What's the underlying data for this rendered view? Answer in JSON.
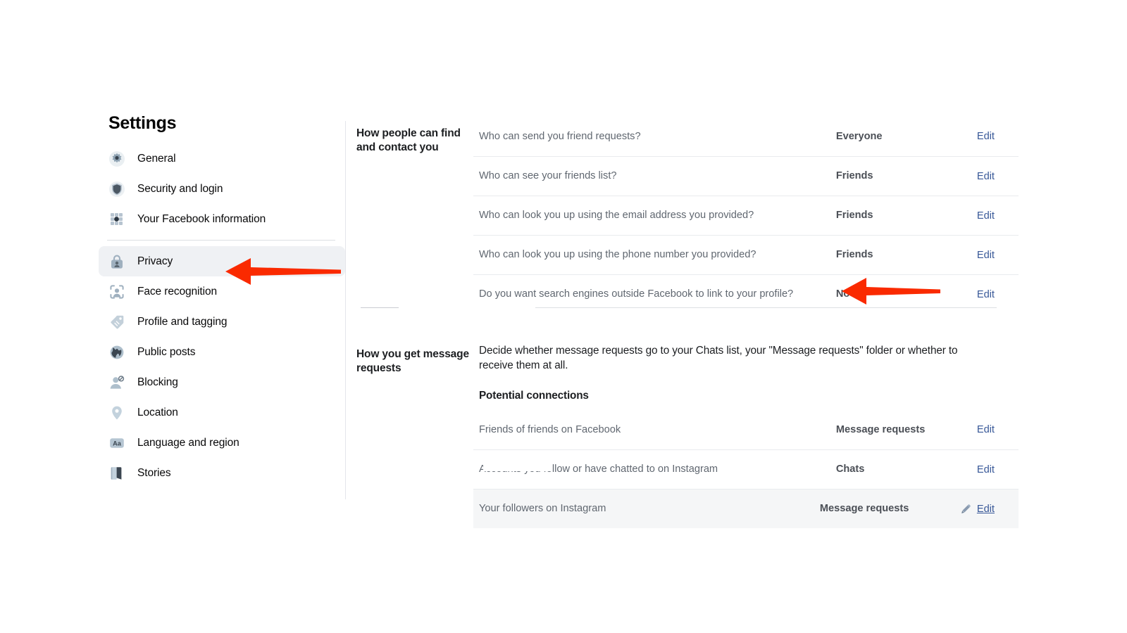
{
  "sidebar": {
    "title": "Settings",
    "items": [
      {
        "label": "General",
        "icon": "gear-icon",
        "active": false
      },
      {
        "label": "Security and login",
        "icon": "shield-icon",
        "active": false
      },
      {
        "label": "Your Facebook information",
        "icon": "grid-dots-icon",
        "active": false
      },
      {
        "label": "Privacy",
        "icon": "lock-person-icon",
        "active": true
      },
      {
        "label": "Face recognition",
        "icon": "face-scan-icon",
        "active": false
      },
      {
        "label": "Profile and tagging",
        "icon": "tag-icon",
        "active": false
      },
      {
        "label": "Public posts",
        "icon": "globe-icon",
        "active": false
      },
      {
        "label": "Blocking",
        "icon": "person-blocked-icon",
        "active": false
      },
      {
        "label": "Location",
        "icon": "map-pin-icon",
        "active": false
      },
      {
        "label": "Language and region",
        "icon": "language-aa-icon",
        "active": false
      },
      {
        "label": "Stories",
        "icon": "book-icon",
        "active": false
      }
    ]
  },
  "main": {
    "sections": [
      {
        "label": "How people can find and contact you",
        "rows": [
          {
            "question": "Who can send you friend requests?",
            "value": "Everyone",
            "action": "Edit"
          },
          {
            "question": "Who can see your friends list?",
            "value": "Friends",
            "action": "Edit"
          },
          {
            "question": "Who can look you up using the email address you provided?",
            "value": "Friends",
            "action": "Edit"
          },
          {
            "question": "Who can look you up using the phone number you provided?",
            "value": "Friends",
            "action": "Edit"
          },
          {
            "question": "Do you want search engines outside Facebook to link to your profile?",
            "value": "No",
            "action": "Edit"
          }
        ]
      },
      {
        "label": "How you get message requests",
        "description": "Decide whether message requests go to your Chats list, your \"Message requests\" folder or whether to receive them at all.",
        "subheading": "Potential connections",
        "rows": [
          {
            "question": "Friends of friends on Facebook",
            "value": "Message requests",
            "action": "Edit"
          },
          {
            "question": "Accounts you follow or have chatted to on Instagram",
            "value": "Chats",
            "action": "Edit"
          },
          {
            "question": "Your followers on Instagram",
            "value": "Message requests",
            "action": "Edit"
          }
        ]
      }
    ]
  },
  "annotations": {
    "arrows": [
      {
        "name": "arrow-pointing-to-privacy",
        "target": "Privacy",
        "direction": "left",
        "color": "#FA2A00"
      },
      {
        "name": "arrow-pointing-to-search-engine-value",
        "target": "No",
        "direction": "left",
        "color": "#FA2A00"
      }
    ]
  },
  "colors": {
    "link": "#385898",
    "arrow": "#FA2A00",
    "active_row_bg": "#eff1f4",
    "highlight_row_bg": "#f5f6f7",
    "text_primary": "#1c1e21",
    "text_secondary": "#606770"
  }
}
